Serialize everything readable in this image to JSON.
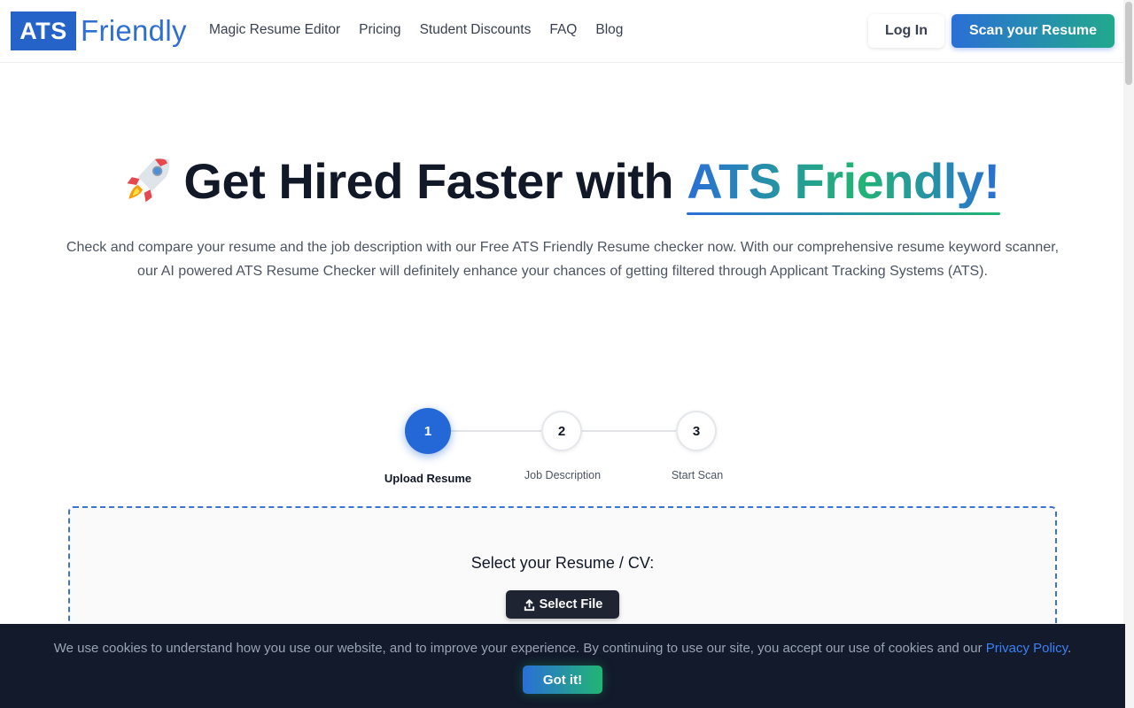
{
  "header": {
    "logo_box": "ATS",
    "logo_text": "Friendly",
    "nav": [
      {
        "label": "Magic Resume Editor"
      },
      {
        "label": "Pricing"
      },
      {
        "label": "Student Discounts"
      },
      {
        "label": "FAQ"
      },
      {
        "label": "Blog"
      }
    ],
    "login_label": "Log In",
    "scan_label": "Scan your Resume"
  },
  "hero": {
    "title_lead": "Get Hired Faster with ",
    "title_brand": "ATS Friendly!",
    "rocket_icon": "rocket-icon",
    "description": "Check and compare your resume and the job description with our Free ATS Friendly Resume checker now. With our comprehensive resume keyword scanner, our AI powered ATS Resume Checker will definitely enhance your chances of getting filtered through Applicant Tracking Systems (ATS)."
  },
  "stepper": {
    "steps": [
      {
        "number": "1",
        "label": "Upload Resume",
        "active": true
      },
      {
        "number": "2",
        "label": "Job Description",
        "active": false
      },
      {
        "number": "3",
        "label": "Start Scan",
        "active": false
      }
    ]
  },
  "upload": {
    "label": "Select your Resume / CV:",
    "button_label": "Select File",
    "button_icon": "upload-icon"
  },
  "cookie": {
    "text": "We use cookies to understand how you use our website, and to improve your experience. By continuing to use our site, you accept our use of cookies and our ",
    "link_label": "Privacy Policy",
    "link_suffix": ".",
    "button_label": "Got it!"
  },
  "colors": {
    "brand_blue": "#2563c9",
    "brand_green": "#22b573",
    "dark": "#121a2b"
  }
}
